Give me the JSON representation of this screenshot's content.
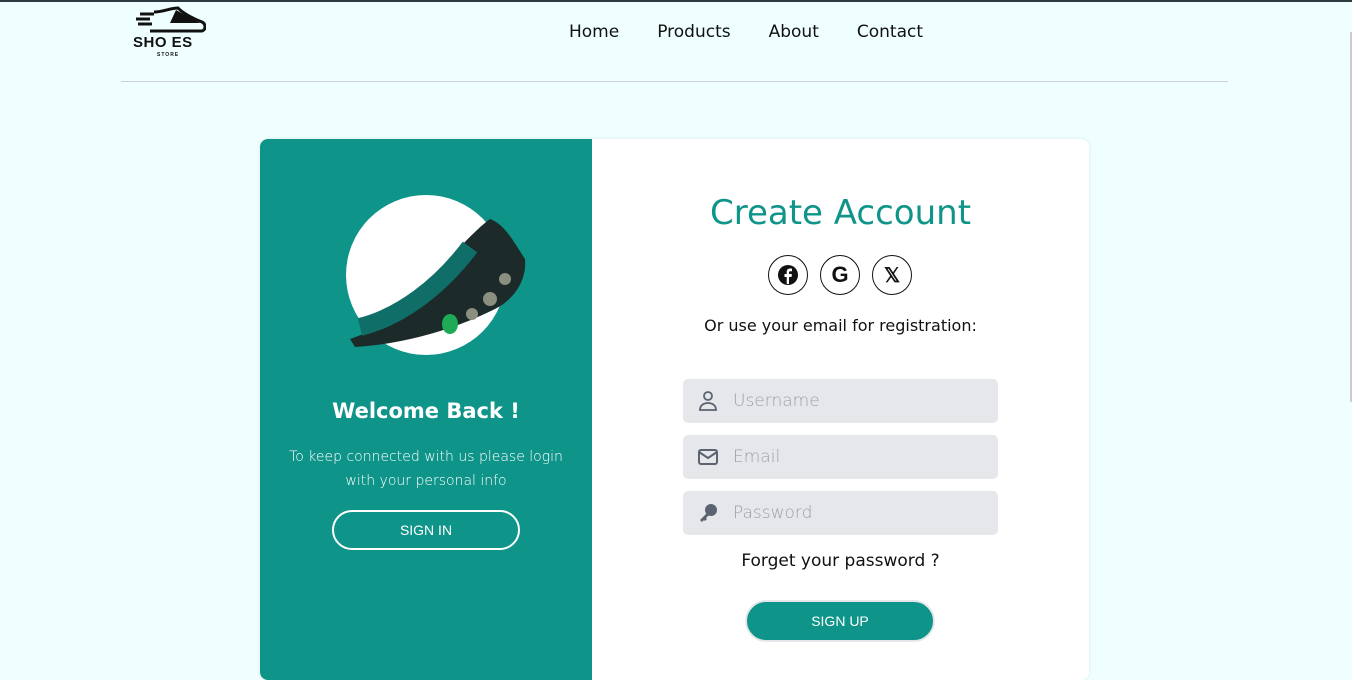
{
  "logo": {
    "text": "SHO ES",
    "subtext": "STORE"
  },
  "nav": [
    "Home",
    "Products",
    "About",
    "Contact"
  ],
  "welcome": {
    "title": "Welcome Back !",
    "text": "To keep connected with us please login with your personal info",
    "button": "SIGN IN"
  },
  "signup": {
    "title": "Create Account",
    "socials": [
      "facebook",
      "google",
      "x"
    ],
    "or_text": "Or use your email for registration:",
    "fields": {
      "username": "Username",
      "email": "Email",
      "password": "Password"
    },
    "forgot": "Forget your password ?",
    "button": "SIGN UP"
  },
  "colors": {
    "accent": "#0e9488",
    "bg": "#effefe"
  }
}
